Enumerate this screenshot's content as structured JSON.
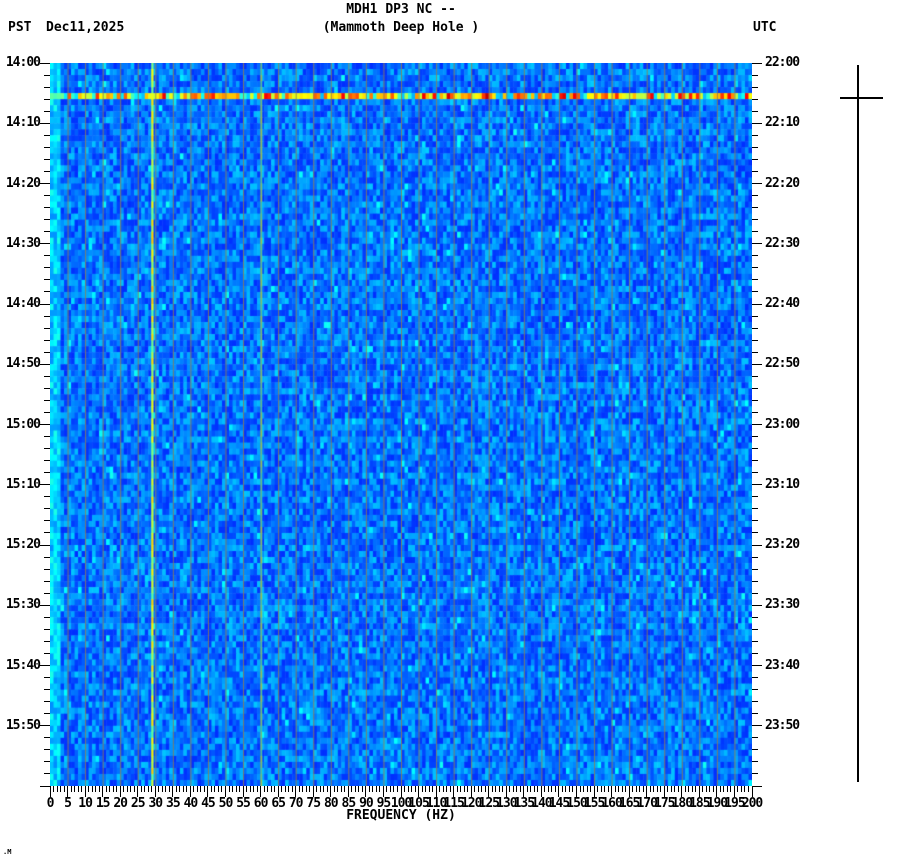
{
  "header": {
    "title_line1": "MDH1 DP3 NC --",
    "title_line2": "(Mammoth Deep Hole )",
    "tz_left": "PST",
    "date": "Dec11,2025",
    "tz_right": "UTC"
  },
  "x_axis": {
    "label": "FREQUENCY (HZ)",
    "min_hz": 0,
    "max_hz": 200,
    "major_step_hz": 5,
    "minor_step_hz": 1,
    "tick_labels": [
      "0",
      "5",
      "10",
      "15",
      "20",
      "25",
      "30",
      "35",
      "40",
      "45",
      "50",
      "55",
      "60",
      "65",
      "70",
      "75",
      "80",
      "85",
      "90",
      "95",
      "100",
      "105",
      "110",
      "115",
      "120",
      "125",
      "130",
      "135",
      "140",
      "145",
      "150",
      "155",
      "160",
      "165",
      "170",
      "175",
      "180",
      "185",
      "190",
      "195",
      "200"
    ]
  },
  "y_axis_left": {
    "timezone": "PST",
    "major_step_min": 10,
    "minor_step_min": 2,
    "tick_labels": [
      "14:00",
      "14:10",
      "14:20",
      "14:30",
      "14:40",
      "14:50",
      "15:00",
      "15:10",
      "15:20",
      "15:30",
      "15:40",
      "15:50"
    ]
  },
  "y_axis_right": {
    "timezone": "UTC",
    "major_step_min": 10,
    "minor_step_min": 2,
    "tick_labels": [
      "22:00",
      "22:10",
      "22:20",
      "22:30",
      "22:40",
      "22:50",
      "23:00",
      "23:10",
      "23:20",
      "23:30",
      "23:40",
      "23:50"
    ]
  },
  "footer_glyph": ".M",
  "chart_data": {
    "type": "heatmap",
    "title": "MDH1 DP3 NC -- (Mammoth Deep Hole )",
    "xlabel": "FREQUENCY (HZ)",
    "x_range_hz": [
      0,
      200
    ],
    "time_start_pst": "14:00",
    "time_end_pst": "16:00",
    "time_start_utc": "22:00",
    "time_end_utc": "24:00",
    "date": "Dec11,2025",
    "grid": "vertical tan gridlines every 5 Hz over full height",
    "palette": {
      "background_blues": [
        "#0040f0",
        "#0070ff",
        "#0098ff",
        "#00b8ff"
      ],
      "event_hot": [
        "#00ffff",
        "#80ff80",
        "#ffff00",
        "#ff8000",
        "#ff2000"
      ],
      "gridline": "#907c50",
      "line_29hz": "#c8e830",
      "line_60hz": "#60e890"
    },
    "features": [
      {
        "name": "broadband-event-band",
        "time_pst": "14:05",
        "time_utc": "22:05",
        "extent_hz": [
          0,
          200
        ],
        "description": "single horizontal row of cyan/yellow/orange/red cells spanning all frequencies"
      },
      {
        "name": "persistent-spectral-line",
        "freq_hz": 29,
        "description": "bright yellow-green vertical line for entire duration"
      },
      {
        "name": "persistent-spectral-line",
        "freq_hz": 60,
        "description": "fainter green-cyan vertical line for entire duration"
      },
      {
        "name": "low-frequency-energy",
        "extent_hz": [
          0,
          2
        ],
        "description": "brighter cyan cells along left edge"
      }
    ],
    "seismogram_trace": {
      "description": "flat vertical amplitude trace at right side with one large spike",
      "spike_time_pst": "14:05",
      "spike_time_utc": "22:05"
    }
  }
}
